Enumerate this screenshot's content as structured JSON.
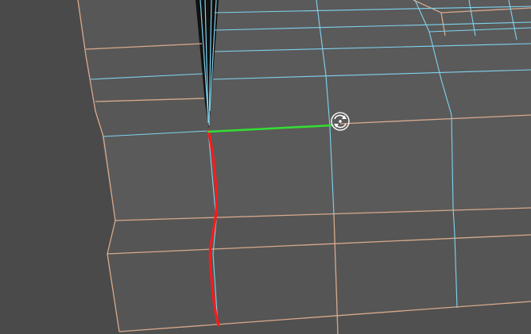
{
  "viewport": {
    "view": "perspective",
    "background_color": "#4a4a4a",
    "mesh": {
      "face_color": "#595959",
      "face_dark_color": "#4f4f4f",
      "boundary_edge_color": "#d9a98c",
      "interior_edge_color": "#7fd3ef",
      "crevice_color": "#111111"
    },
    "selection": {
      "active_edge_color": "#ff1a1a",
      "guide_edge_color": "#33dd33"
    },
    "gizmo": {
      "icon": "rotate-icon",
      "color": "#ffffff"
    }
  }
}
